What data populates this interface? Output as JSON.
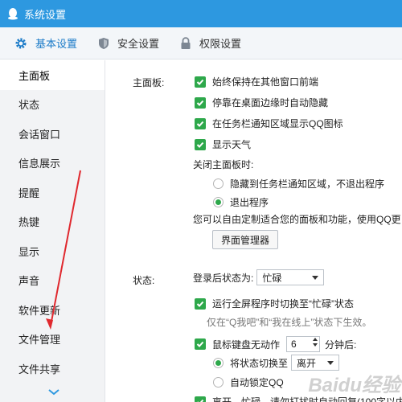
{
  "window": {
    "title": "系统设置"
  },
  "tabs": [
    {
      "label": "基本设置",
      "icon": "gear-icon",
      "active": true
    },
    {
      "label": "安全设置",
      "icon": "shield-icon",
      "active": false
    },
    {
      "label": "权限设置",
      "icon": "lock-icon",
      "active": false
    }
  ],
  "sidebar": {
    "items": [
      {
        "label": "主面板",
        "active": true
      },
      {
        "label": "状态"
      },
      {
        "label": "会话窗口"
      },
      {
        "label": "信息展示"
      },
      {
        "label": "提醒"
      },
      {
        "label": "热键"
      },
      {
        "label": "显示"
      },
      {
        "label": "声音"
      },
      {
        "label": "软件更新"
      },
      {
        "label": "文件管理"
      },
      {
        "label": "文件共享"
      }
    ]
  },
  "main_panel": {
    "label": "主面板:",
    "options": [
      "始终保持在其他窗口前端",
      "停靠在桌面边缘时自动隐藏",
      "在任务栏通知区域显示QQ图标",
      "显示天气"
    ],
    "close_label": "关闭主面板时:",
    "close_options": [
      {
        "label": "隐藏到任务栏通知区域，不退出程序",
        "selected": false
      },
      {
        "label": "退出程序",
        "selected": true
      }
    ],
    "customize_text": "您可以自由定制适合您的面板和功能，使用QQ更",
    "manager_button": "界面管理器"
  },
  "status": {
    "label": "状态:",
    "after_login_label": "登录后状态为:",
    "after_login_value": "忙碌",
    "fullscreen_option": "运行全屏程序时切换至“忙碌”状态",
    "fullscreen_hint": "仅在“Q我吧”和“我在线上”状态下生效。",
    "idle_option_prefix": "鼠标键盘无动作",
    "idle_minutes": "6",
    "idle_option_suffix": "分钟后:",
    "switch_label": "将状态切换至",
    "switch_value": "离开",
    "auto_lock": "自动锁定QQ",
    "auto_reply": "离开、忙碌、请勿打扰时自动回复(100字以内"
  },
  "watermark": "Baidu经验",
  "colors": {
    "titlebar": "#2d98e0",
    "check": "#2ea84b",
    "accent_tab": "#1b7bc8",
    "annotation_arrow": "#e0282e"
  }
}
